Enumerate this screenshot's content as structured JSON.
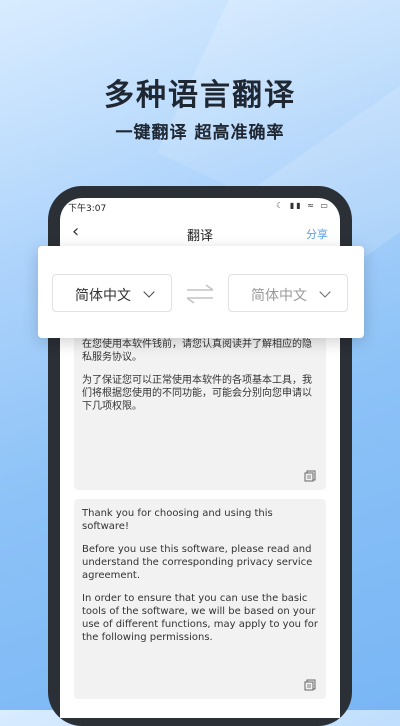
{
  "headline": "多种语言翻译",
  "subline": "一键翻译   超高准确率",
  "status": {
    "time": "下午3:07",
    "icons": "☾ ▮▮ ≈ ▭"
  },
  "nav": {
    "back": "‹",
    "title": "翻译",
    "share": "分享"
  },
  "lang": {
    "source": "简体中文",
    "target": "简体中文"
  },
  "panels": {
    "cn_p1": "在您使用本软件钱前，请您认真阅读并了解相应的隐私服务协议。",
    "cn_p2": "为了保证您可以正常使用本软件的各项基本工具，我们将根据您使用的不同功能，可能会分别向您申请以下几项权限。",
    "en_p1": "Thank you for choosing and using this software!",
    "en_p2": "Before you use this software, please read and understand the corresponding privacy service agreement.",
    "en_p3": "In order to ensure that you can use the basic tools of the software, we will be based on your use of different functions, may apply to you for the following permissions."
  },
  "colors": {
    "accent": "#5aa2e6",
    "phone": "#2b2f36"
  }
}
